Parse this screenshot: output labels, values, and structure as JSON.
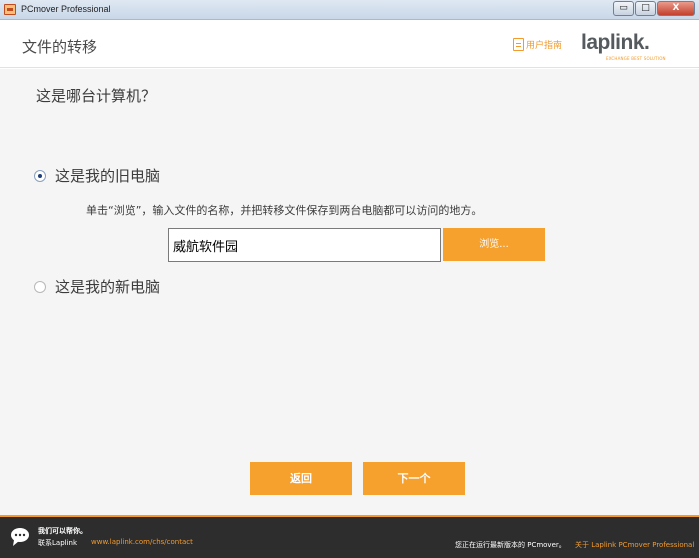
{
  "window": {
    "title": "PCmover Professional",
    "buttons": {
      "minimize": "▭",
      "maximize": "□",
      "close": "X"
    }
  },
  "header": {
    "title": "文件的转移",
    "guide_link": "用户指南",
    "logo": "laplink.",
    "logo_tagline": "EXCHANGE BEST SOLUTION"
  },
  "main": {
    "question": "这是哪台计算机？",
    "options": [
      {
        "label": "这是我的旧电脑",
        "selected": true
      },
      {
        "label": "这是我的新电脑",
        "selected": false
      }
    ],
    "hint": "单击“浏览”，输入文件的名称，并把转移文件保存到两台电脑都可以访问的地方。",
    "path_value": "威航软件园",
    "browse_label": "浏览...",
    "back_label": "返回",
    "next_label": "下一个"
  },
  "footer": {
    "help_text": "我们可以帮你。",
    "contact_label": "联系Laplink",
    "contact_url": "www.laplink.com/chs/contact",
    "status_text": "您正在运行最新版本的 PCmover。",
    "about_link": "关于 Laplink PCmover Professional"
  },
  "colors": {
    "accent": "#f6a02d",
    "footer_bg": "#2d2d2d",
    "content_bg": "#f5f5f5"
  }
}
